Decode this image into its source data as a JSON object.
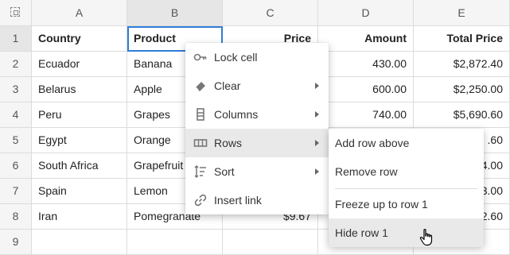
{
  "columns": [
    "A",
    "B",
    "C",
    "D",
    "E"
  ],
  "rows": [
    {
      "num": "1",
      "a": "Country",
      "b": "Product",
      "c": "Price",
      "d": "Amount",
      "e": "Total Price"
    },
    {
      "num": "2",
      "a": "Ecuador",
      "b": "Banana",
      "c": "",
      "d": "430.00",
      "e": "$2,872.40"
    },
    {
      "num": "3",
      "a": "Belarus",
      "b": "Apple",
      "c": "",
      "d": "600.00",
      "e": "$2,250.00"
    },
    {
      "num": "4",
      "a": "Peru",
      "b": "Grapes",
      "c": "",
      "d": "740.00",
      "e": "$5,690.60"
    },
    {
      "num": "5",
      "a": "Egypt",
      "b": "Orange",
      "c": "",
      "d": "",
      "e": ".60"
    },
    {
      "num": "6",
      "a": "South Africa",
      "b": "Grapefruit",
      "c": "",
      "d": "",
      "e": "4.00"
    },
    {
      "num": "7",
      "a": "Spain",
      "b": "Lemon",
      "c": "",
      "d": "",
      "e": "3.00"
    },
    {
      "num": "8",
      "a": "Iran",
      "b": "Pomegranate",
      "c": "$9.67",
      "d": "",
      "e": "2.60"
    },
    {
      "num": "9",
      "a": "",
      "b": "",
      "c": "",
      "d": "",
      "e": ""
    }
  ],
  "context_menu": {
    "items": [
      {
        "label": "Lock cell",
        "icon": "key-icon"
      },
      {
        "label": "Clear",
        "icon": "eraser-icon"
      },
      {
        "label": "Columns",
        "icon": "columns-icon"
      },
      {
        "label": "Rows",
        "icon": "rows-icon"
      },
      {
        "label": "Sort",
        "icon": "sort-icon"
      },
      {
        "label": "Insert link",
        "icon": "link-icon"
      }
    ]
  },
  "submenu": {
    "items": [
      {
        "label": "Add row above"
      },
      {
        "label": "Remove row"
      },
      {
        "label": "Freeze up to row 1"
      },
      {
        "label": "Hide row 1"
      }
    ]
  },
  "colors": {
    "selection": "#2f7dd8",
    "header_bg": "#f5f5f5",
    "highlight": "#e9e9e9"
  }
}
